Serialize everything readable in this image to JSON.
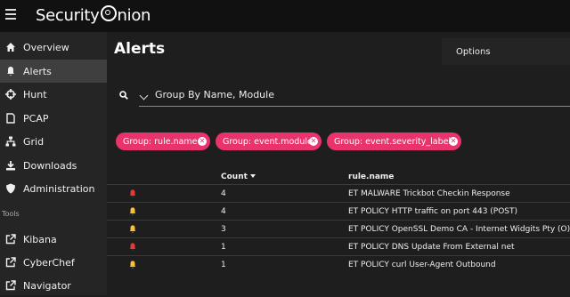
{
  "brand": {
    "name_left": "Security",
    "name_right": "nion"
  },
  "sidebar": {
    "items": [
      {
        "label": "Overview",
        "icon": "home-icon"
      },
      {
        "label": "Alerts",
        "icon": "bell-icon",
        "active": true
      },
      {
        "label": "Hunt",
        "icon": "crosshairs-icon"
      },
      {
        "label": "PCAP",
        "icon": "file-icon"
      },
      {
        "label": "Grid",
        "icon": "sitemap-icon"
      },
      {
        "label": "Downloads",
        "icon": "download-icon"
      },
      {
        "label": "Administration",
        "icon": "shield-icon"
      }
    ],
    "tools_label": "Tools",
    "tools": [
      {
        "label": "Kibana",
        "icon": "external-link-icon"
      },
      {
        "label": "CyberChef",
        "icon": "external-link-icon"
      },
      {
        "label": "Navigator",
        "icon": "external-link-icon"
      }
    ]
  },
  "main": {
    "title": "Alerts",
    "options_label": "Options",
    "groupby_value": "Group By Name, Module",
    "chips": [
      {
        "label": "Group: rule.name"
      },
      {
        "label": "Group: event.module"
      },
      {
        "label": "Group: event.severity_label"
      }
    ],
    "table": {
      "headers": {
        "count": "Count",
        "rule": "rule.name"
      },
      "rows": [
        {
          "severity": "high",
          "count": "4",
          "rule": "ET MALWARE Trickbot Checkin Response"
        },
        {
          "severity": "medium",
          "count": "4",
          "rule": "ET POLICY HTTP traffic on port 443 (POST)"
        },
        {
          "severity": "medium",
          "count": "3",
          "rule": "ET POLICY OpenSSL Demo CA - Internet Widgits Pty (O)"
        },
        {
          "severity": "high",
          "count": "1",
          "rule": "ET POLICY DNS Update From External net"
        },
        {
          "severity": "medium",
          "count": "1",
          "rule": "ET POLICY curl User-Agent Outbound"
        }
      ]
    }
  },
  "colors": {
    "high": "#e53935",
    "medium": "#fbc02d",
    "chip": "#e8336d"
  }
}
